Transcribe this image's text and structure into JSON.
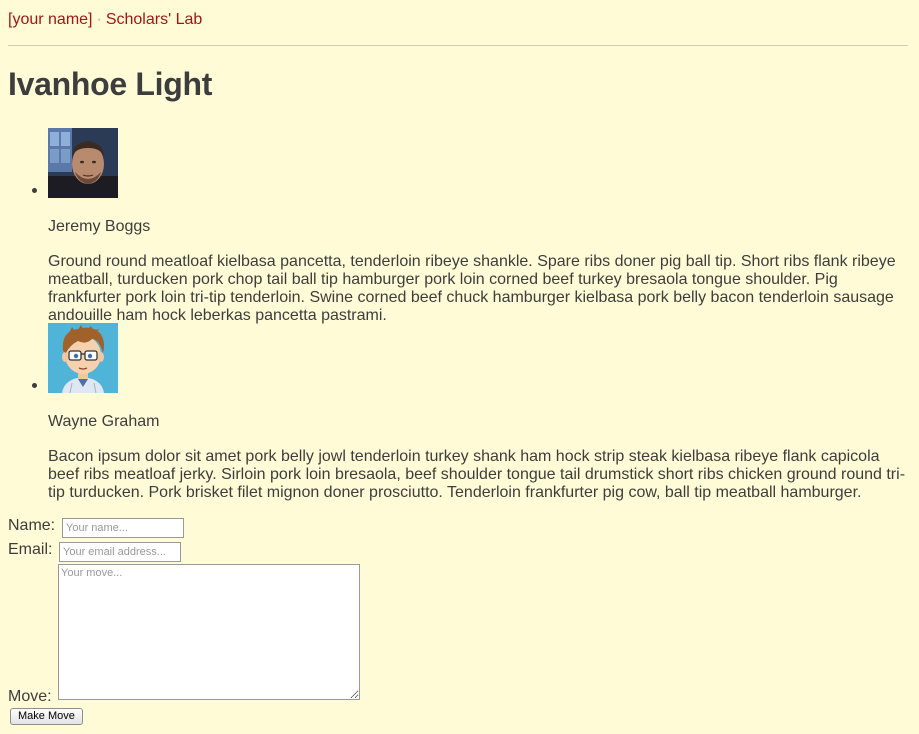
{
  "nav": {
    "user_link": "[your name]",
    "site_link": "Scholars' Lab",
    "separator": "·"
  },
  "page_title": "Ivanhoe Light",
  "players": [
    {
      "name": "Jeremy Boggs",
      "bio": "Ground round meatloaf kielbasa pancetta, tenderloin ribeye shankle. Spare ribs doner pig ball tip. Short ribs flank ribeye meatball, turducken pork chop tail ball tip hamburger pork loin corned beef turkey bresaola tongue shoulder. Pig frankfurter pork loin tri-tip tenderloin. Swine corned beef chuck hamburger kielbasa pork belly bacon tenderloin sausage andouille ham hock leberkas pancetta pastrami."
    },
    {
      "name": "Wayne Graham",
      "bio": "Bacon ipsum dolor sit amet pork belly jowl tenderloin turkey shank ham hock strip steak kielbasa ribeye flank capicola beef ribs meatloaf jerky. Sirloin pork loin bresaola, beef shoulder tongue tail drumstick short ribs chicken ground round tri-tip turducken. Pork brisket filet mignon doner prosciutto. Tenderloin frankfurter pig cow, ball tip meatball hamburger."
    }
  ],
  "form": {
    "name_label": "Name:",
    "name_placeholder": "Your name...",
    "name_value": "",
    "email_label": "Email:",
    "email_placeholder": "Your email address...",
    "email_value": "",
    "move_label": "Move:",
    "move_placeholder": "Your move...",
    "move_value": "",
    "submit_label": "Make Move"
  },
  "colors": {
    "background": "#fffbd6",
    "link": "#a31515",
    "text": "#3d3d3d"
  }
}
